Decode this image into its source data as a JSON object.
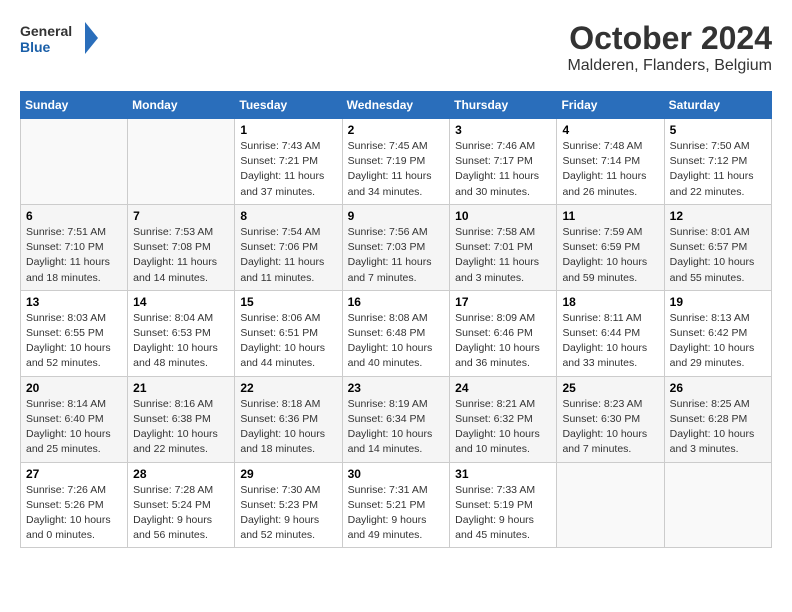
{
  "logo": {
    "line1": "General",
    "line2": "Blue"
  },
  "title": "October 2024",
  "subtitle": "Malderen, Flanders, Belgium",
  "columns": [
    "Sunday",
    "Monday",
    "Tuesday",
    "Wednesday",
    "Thursday",
    "Friday",
    "Saturday"
  ],
  "weeks": [
    [
      {
        "day": "",
        "detail": ""
      },
      {
        "day": "",
        "detail": ""
      },
      {
        "day": "1",
        "detail": "Sunrise: 7:43 AM\nSunset: 7:21 PM\nDaylight: 11 hours\nand 37 minutes."
      },
      {
        "day": "2",
        "detail": "Sunrise: 7:45 AM\nSunset: 7:19 PM\nDaylight: 11 hours\nand 34 minutes."
      },
      {
        "day": "3",
        "detail": "Sunrise: 7:46 AM\nSunset: 7:17 PM\nDaylight: 11 hours\nand 30 minutes."
      },
      {
        "day": "4",
        "detail": "Sunrise: 7:48 AM\nSunset: 7:14 PM\nDaylight: 11 hours\nand 26 minutes."
      },
      {
        "day": "5",
        "detail": "Sunrise: 7:50 AM\nSunset: 7:12 PM\nDaylight: 11 hours\nand 22 minutes."
      }
    ],
    [
      {
        "day": "6",
        "detail": "Sunrise: 7:51 AM\nSunset: 7:10 PM\nDaylight: 11 hours\nand 18 minutes."
      },
      {
        "day": "7",
        "detail": "Sunrise: 7:53 AM\nSunset: 7:08 PM\nDaylight: 11 hours\nand 14 minutes."
      },
      {
        "day": "8",
        "detail": "Sunrise: 7:54 AM\nSunset: 7:06 PM\nDaylight: 11 hours\nand 11 minutes."
      },
      {
        "day": "9",
        "detail": "Sunrise: 7:56 AM\nSunset: 7:03 PM\nDaylight: 11 hours\nand 7 minutes."
      },
      {
        "day": "10",
        "detail": "Sunrise: 7:58 AM\nSunset: 7:01 PM\nDaylight: 11 hours\nand 3 minutes."
      },
      {
        "day": "11",
        "detail": "Sunrise: 7:59 AM\nSunset: 6:59 PM\nDaylight: 10 hours\nand 59 minutes."
      },
      {
        "day": "12",
        "detail": "Sunrise: 8:01 AM\nSunset: 6:57 PM\nDaylight: 10 hours\nand 55 minutes."
      }
    ],
    [
      {
        "day": "13",
        "detail": "Sunrise: 8:03 AM\nSunset: 6:55 PM\nDaylight: 10 hours\nand 52 minutes."
      },
      {
        "day": "14",
        "detail": "Sunrise: 8:04 AM\nSunset: 6:53 PM\nDaylight: 10 hours\nand 48 minutes."
      },
      {
        "day": "15",
        "detail": "Sunrise: 8:06 AM\nSunset: 6:51 PM\nDaylight: 10 hours\nand 44 minutes."
      },
      {
        "day": "16",
        "detail": "Sunrise: 8:08 AM\nSunset: 6:48 PM\nDaylight: 10 hours\nand 40 minutes."
      },
      {
        "day": "17",
        "detail": "Sunrise: 8:09 AM\nSunset: 6:46 PM\nDaylight: 10 hours\nand 36 minutes."
      },
      {
        "day": "18",
        "detail": "Sunrise: 8:11 AM\nSunset: 6:44 PM\nDaylight: 10 hours\nand 33 minutes."
      },
      {
        "day": "19",
        "detail": "Sunrise: 8:13 AM\nSunset: 6:42 PM\nDaylight: 10 hours\nand 29 minutes."
      }
    ],
    [
      {
        "day": "20",
        "detail": "Sunrise: 8:14 AM\nSunset: 6:40 PM\nDaylight: 10 hours\nand 25 minutes."
      },
      {
        "day": "21",
        "detail": "Sunrise: 8:16 AM\nSunset: 6:38 PM\nDaylight: 10 hours\nand 22 minutes."
      },
      {
        "day": "22",
        "detail": "Sunrise: 8:18 AM\nSunset: 6:36 PM\nDaylight: 10 hours\nand 18 minutes."
      },
      {
        "day": "23",
        "detail": "Sunrise: 8:19 AM\nSunset: 6:34 PM\nDaylight: 10 hours\nand 14 minutes."
      },
      {
        "day": "24",
        "detail": "Sunrise: 8:21 AM\nSunset: 6:32 PM\nDaylight: 10 hours\nand 10 minutes."
      },
      {
        "day": "25",
        "detail": "Sunrise: 8:23 AM\nSunset: 6:30 PM\nDaylight: 10 hours\nand 7 minutes."
      },
      {
        "day": "26",
        "detail": "Sunrise: 8:25 AM\nSunset: 6:28 PM\nDaylight: 10 hours\nand 3 minutes."
      }
    ],
    [
      {
        "day": "27",
        "detail": "Sunrise: 7:26 AM\nSunset: 5:26 PM\nDaylight: 10 hours\nand 0 minutes."
      },
      {
        "day": "28",
        "detail": "Sunrise: 7:28 AM\nSunset: 5:24 PM\nDaylight: 9 hours\nand 56 minutes."
      },
      {
        "day": "29",
        "detail": "Sunrise: 7:30 AM\nSunset: 5:23 PM\nDaylight: 9 hours\nand 52 minutes."
      },
      {
        "day": "30",
        "detail": "Sunrise: 7:31 AM\nSunset: 5:21 PM\nDaylight: 9 hours\nand 49 minutes."
      },
      {
        "day": "31",
        "detail": "Sunrise: 7:33 AM\nSunset: 5:19 PM\nDaylight: 9 hours\nand 45 minutes."
      },
      {
        "day": "",
        "detail": ""
      },
      {
        "day": "",
        "detail": ""
      }
    ]
  ]
}
